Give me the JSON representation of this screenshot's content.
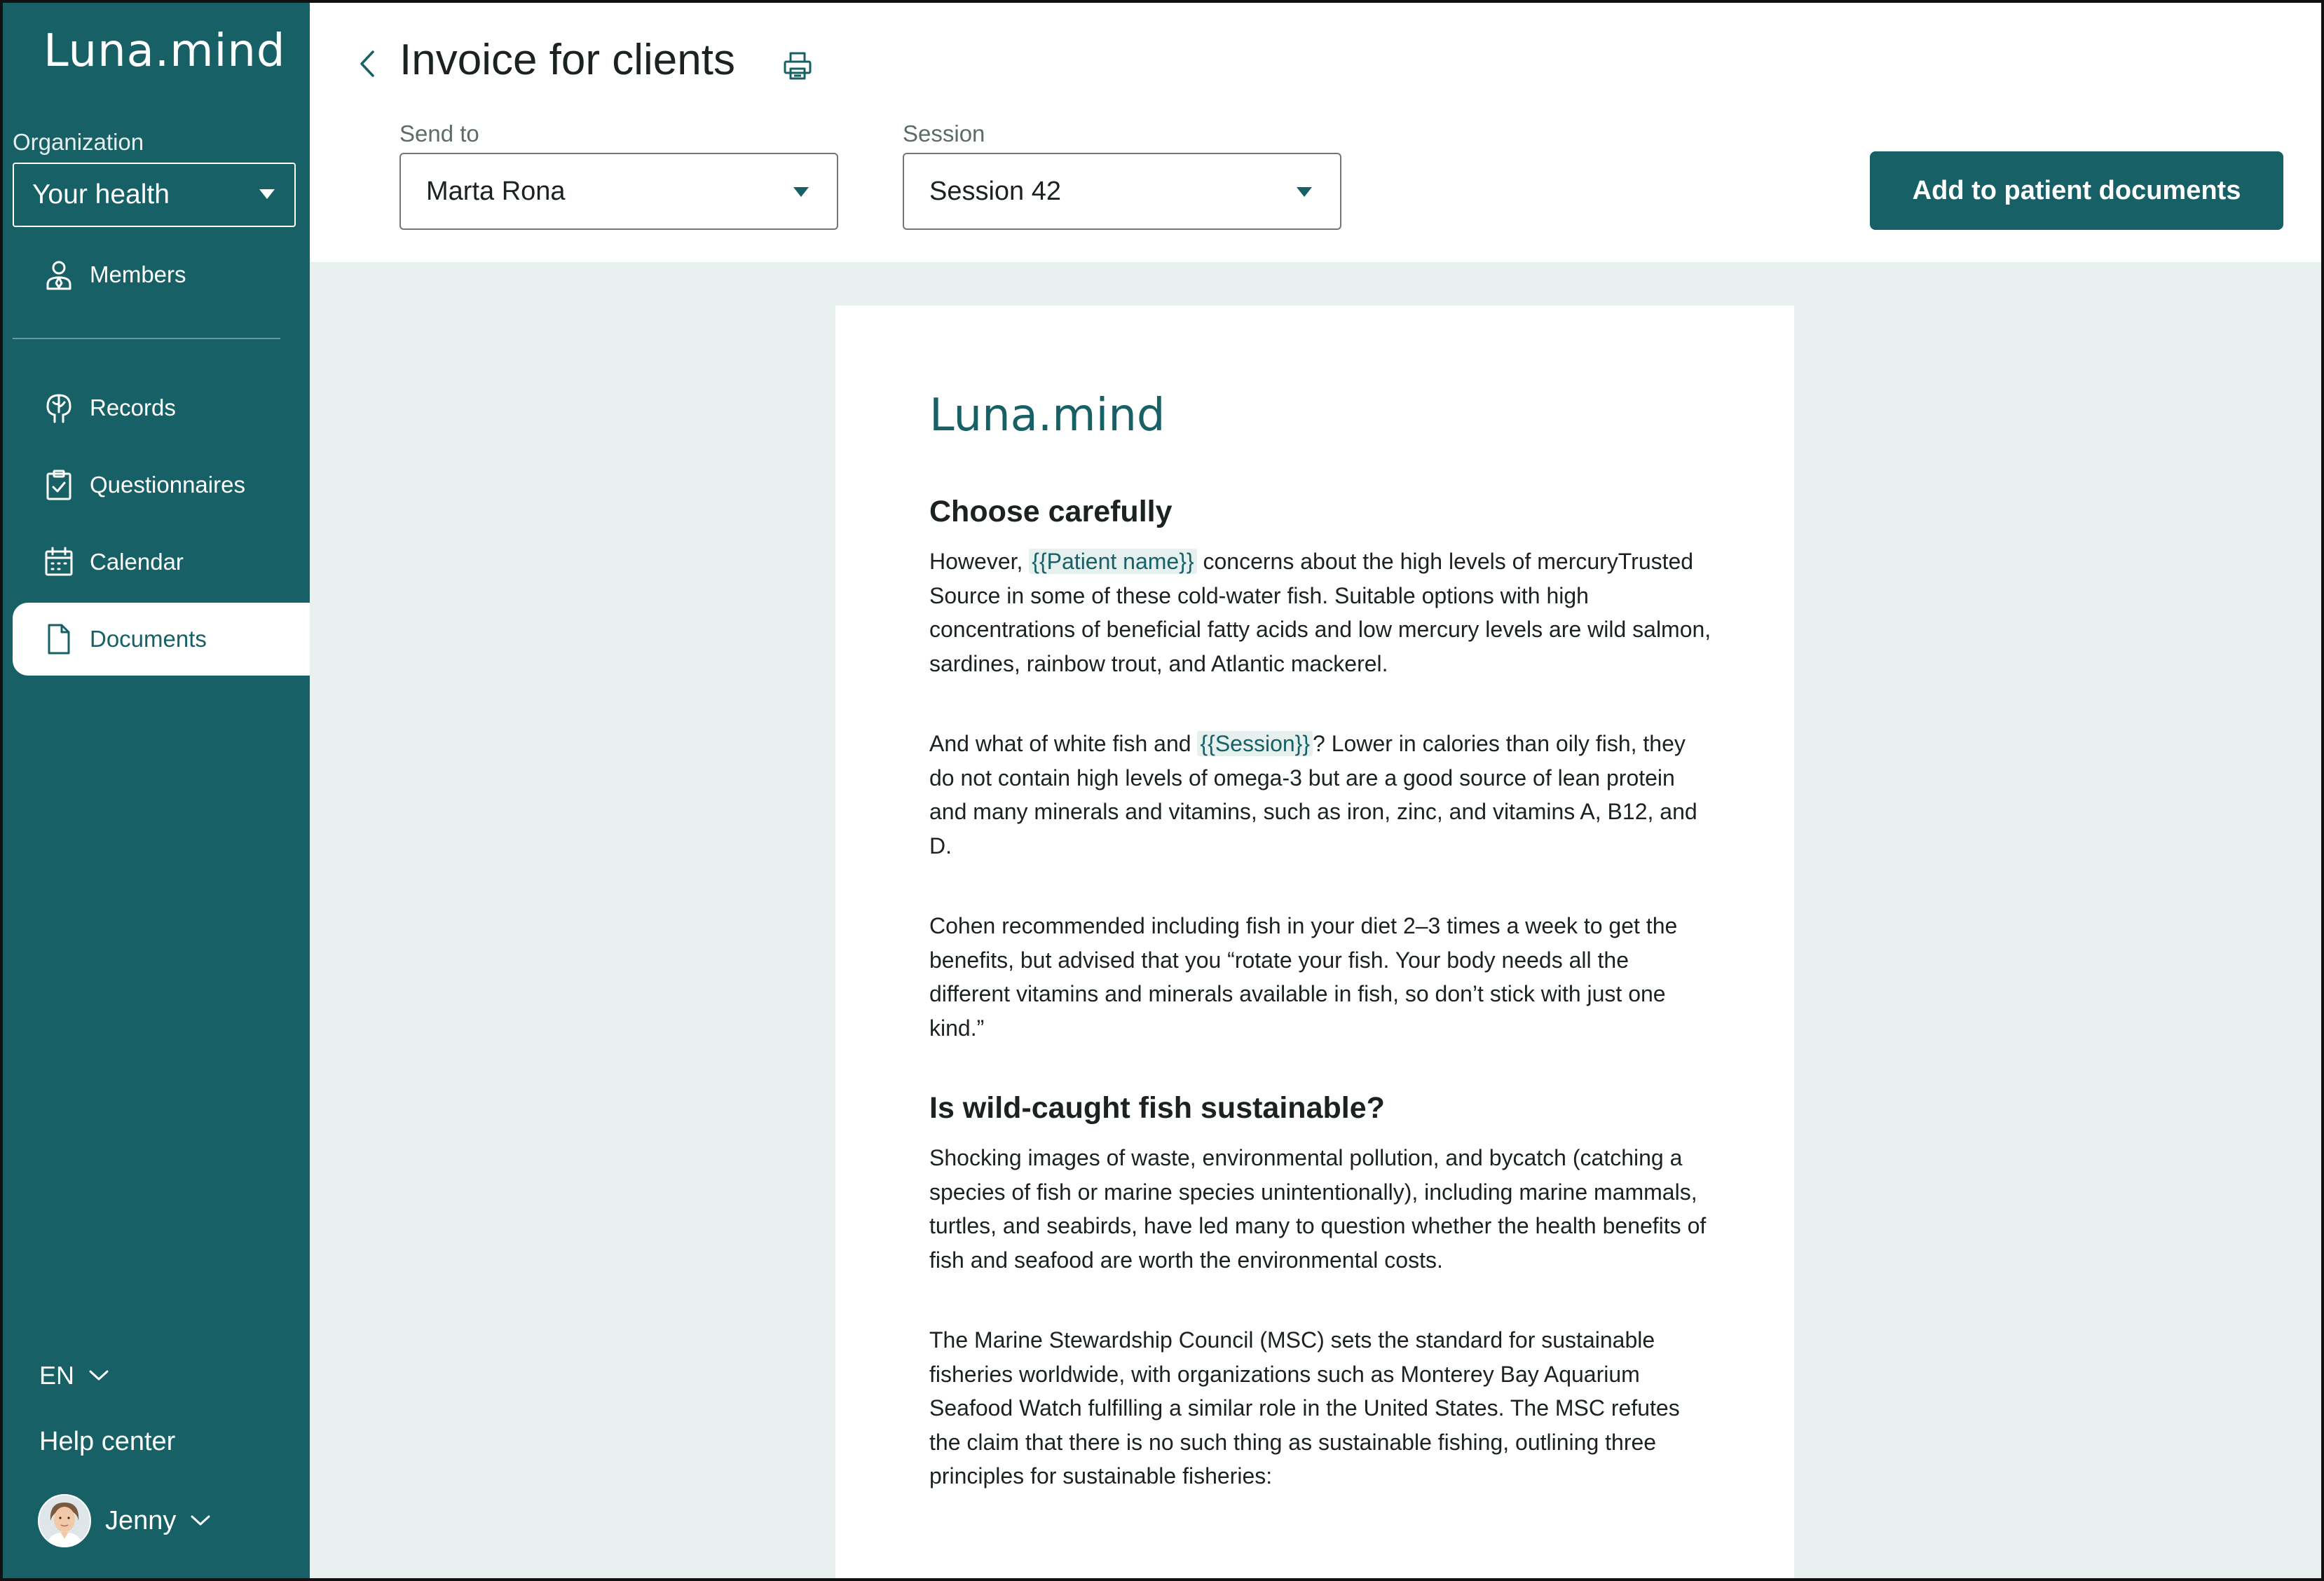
{
  "app": {
    "logo": "Luna.mind"
  },
  "sidebar": {
    "org_label": "Organization",
    "org_value": "Your health",
    "members_label": "Members",
    "items": [
      {
        "label": "Records",
        "icon": "brain-icon"
      },
      {
        "label": "Questionnaires",
        "icon": "clipboard-check-icon"
      },
      {
        "label": "Calendar",
        "icon": "calendar-icon"
      },
      {
        "label": "Documents",
        "icon": "document-icon",
        "active": true
      }
    ],
    "language": "EN",
    "help": "Help center",
    "user_name": "Jenny"
  },
  "header": {
    "title": "Invoice for clients",
    "send_to_label": "Send to",
    "send_to_value": "Marta Rona",
    "session_label": "Session",
    "session_value": "Session 42",
    "primary_button": "Add to patient documents"
  },
  "document": {
    "logo": "Luna.mind",
    "heading1": "Choose carefully",
    "p1_before": "However, ",
    "p1_tag": "{{Patient name}}",
    "p1_after": " concerns about the high levels of mercuryTrusted Source in some of these cold-water fish. Suitable options with high concentrations of beneficial fatty acids and low mercury levels are wild salmon, sardines, rainbow trout, and Atlantic mackerel.",
    "p2_before": "And what of white fish and ",
    "p2_tag": "{{Session}}",
    "p2_after": "? Lower in calories than oily fish, they do not contain high levels of omega-3 but are a good source of lean protein and many minerals and vitamins, such as iron, zinc, and vitamins A, B12, and D.",
    "p3": "Cohen recommended including fish in your diet 2–3 times a week to get the benefits, but advised that you “rotate your fish. Your body needs all the different vitamins and minerals available in fish, so don’t stick with just one kind.”",
    "heading2": "Is wild-caught fish sustainable?",
    "p4": "Shocking images of waste, environmental pollution, and bycatch (catching a species of fish or marine species unintentionally), including marine mammals, turtles, and seabirds, have led many to question whether the health benefits of fish and seafood are worth the environmental costs.",
    "p5": "The Marine Stewardship Council (MSC) sets the standard for sustainable fisheries worldwide, with organizations such as Monterey Bay Aquarium Seafood Watch fulfilling a similar role in the United States. The MSC refutes the claim that there is no such thing as sustainable fishing, outlining three principles for sustainable fisheries:"
  },
  "colors": {
    "brand": "#176166",
    "content_bg": "#e8f0ef",
    "tag_bg": "#e5f0ef"
  }
}
